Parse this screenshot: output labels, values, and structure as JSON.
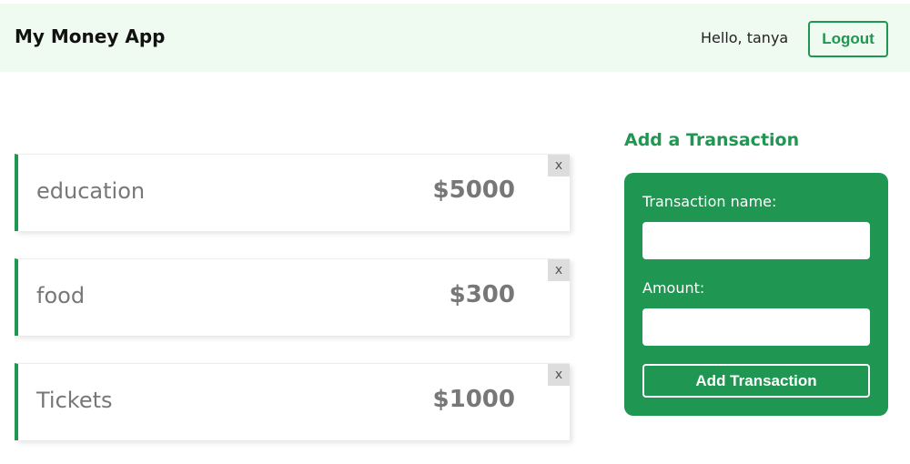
{
  "navbar": {
    "brand": "My Money App",
    "greeting": "Hello, tanya",
    "logout_label": "Logout"
  },
  "transactions": [
    {
      "name": "education",
      "amount": "$5000",
      "delete_label": "x"
    },
    {
      "name": "food",
      "amount": "$300",
      "delete_label": "x"
    },
    {
      "name": "Tickets",
      "amount": "$1000",
      "delete_label": "x"
    }
  ],
  "form": {
    "title": "Add a Transaction",
    "name_label": "Transaction name:",
    "name_value": "",
    "amount_label": "Amount:",
    "amount_value": "",
    "submit_label": "Add Transaction"
  },
  "colors": {
    "accent": "#1f9651",
    "navbar_bg": "#effaf0",
    "muted_text": "#777777",
    "delete_bg": "#dddddd"
  }
}
